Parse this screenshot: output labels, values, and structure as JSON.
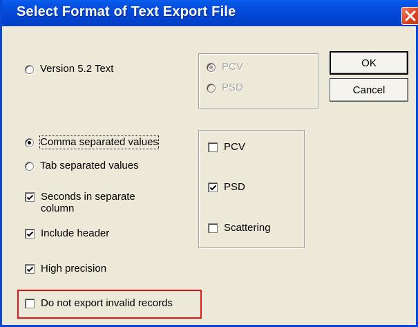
{
  "dialog": {
    "title": "Select Format of Text Export File"
  },
  "buttons": {
    "ok": "OK",
    "cancel": "Cancel"
  },
  "version_group": {
    "radio_label": "Version 5.2 Text",
    "sub_options": [
      {
        "label": "PCV",
        "checked": true,
        "enabled": false
      },
      {
        "label": "PSD",
        "checked": false,
        "enabled": false
      }
    ]
  },
  "format_options": {
    "comma": {
      "label": "Comma separated values",
      "checked": true
    },
    "tab": {
      "label": "Tab separated values",
      "checked": false
    }
  },
  "checkboxes": {
    "seconds": {
      "label": "Seconds in separate column",
      "checked": true
    },
    "header": {
      "label": "Include header",
      "checked": true
    },
    "precision": {
      "label": "High precision",
      "checked": true
    },
    "invalid": {
      "label": "Do not export invalid records",
      "checked": false
    }
  },
  "data_group": [
    {
      "label": "PCV",
      "checked": false
    },
    {
      "label": "PSD",
      "checked": true
    },
    {
      "label": "Scattering",
      "checked": false
    }
  ],
  "colors": {
    "titlebar": "#0346d6",
    "dialog_bg": "#ece9d8",
    "highlight": "#e01818"
  }
}
